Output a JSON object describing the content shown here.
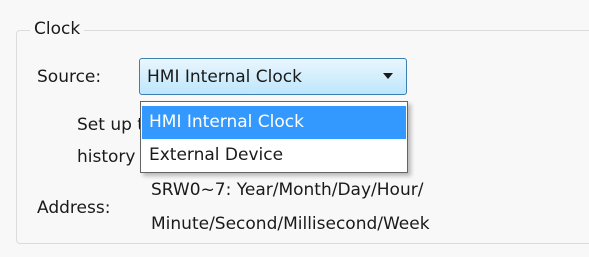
{
  "clock": {
    "title": "Clock",
    "source_label": "Source:",
    "source_value": "HMI Internal Clock",
    "source_options": [
      "HMI Internal Clock",
      "External Device"
    ],
    "description_line1": "Set up the clock for alarm, events,",
    "description_line2": "history record, etc.",
    "address_label": "Address:",
    "address_line1": "SRW0~7: Year/Month/Day/Hour/",
    "address_line2": "Minute/Second/Millisecond/Week"
  },
  "colors": {
    "selection": "#3399ff",
    "combo_border": "#3c7fb1"
  },
  "icons": {
    "combo_arrow": "chevron-down-icon"
  }
}
